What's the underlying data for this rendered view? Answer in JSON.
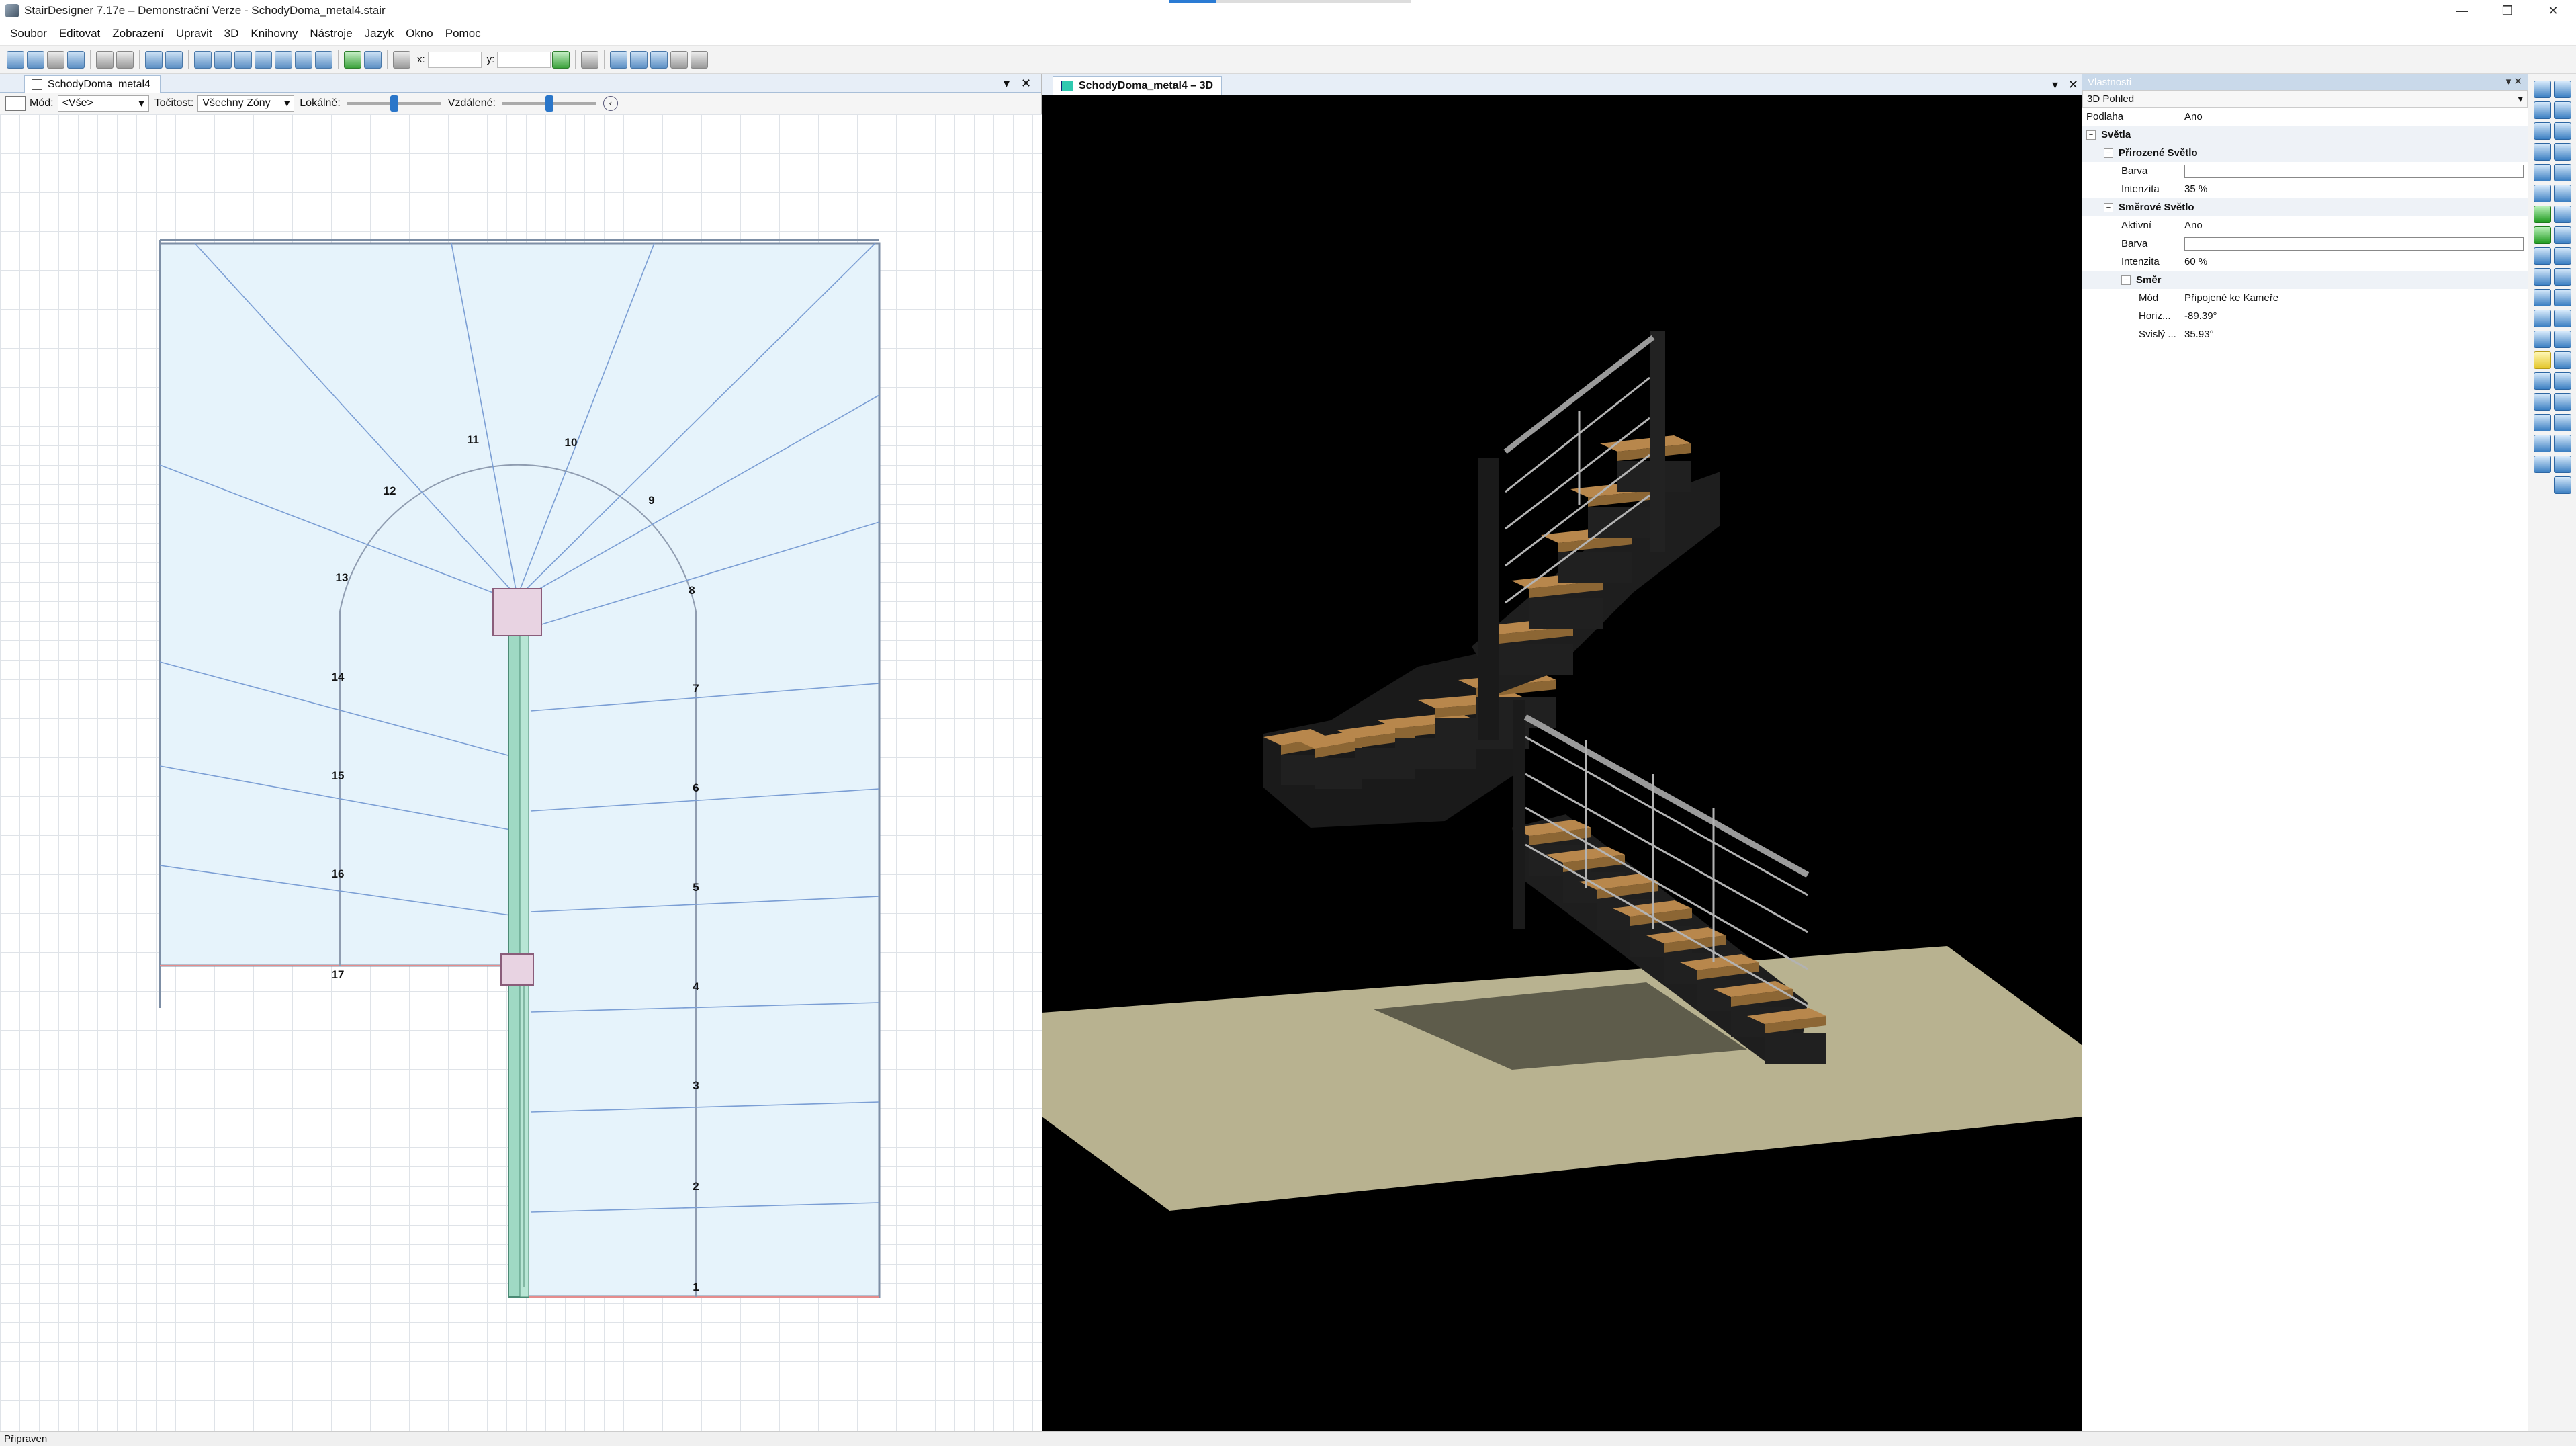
{
  "window": {
    "title": "StairDesigner 7.17e – Demonstrační Verze - SchodyDoma_metal4.stair"
  },
  "menu": [
    "Soubor",
    "Editovat",
    "Zobrazení",
    "Upravit",
    "3D",
    "Knihovny",
    "Nástroje",
    "Jazyk",
    "Okno",
    "Pomoc"
  ],
  "toolbar": {
    "x_label": "x:",
    "y_label": "y:"
  },
  "plan": {
    "tab": "SchodyDoma_metal4",
    "mode_label": "Mód:",
    "mode_value": "<Vše>",
    "turning_label": "Točitost:",
    "turning_value": "Všechny Zóny",
    "local_label": "Lokálně:",
    "remote_label": "Vzdálené:",
    "local_level": 0.5,
    "remote_level": 0.5,
    "step_numbers": [
      "1",
      "2",
      "3",
      "4",
      "5",
      "6",
      "7",
      "8",
      "9",
      "10",
      "11",
      "12",
      "13",
      "14",
      "15",
      "16",
      "17"
    ]
  },
  "view3d": {
    "tab": "SchodyDoma_metal4 – 3D"
  },
  "properties": {
    "header": "Vlastnosti",
    "header_controls": "▾ ✕",
    "object": "3D Pohled",
    "rows": [
      {
        "type": "row",
        "key": "Podlaha",
        "value": "Ano",
        "indent": 0
      },
      {
        "type": "cat",
        "key": "Světla",
        "indent": 0
      },
      {
        "type": "cat",
        "key": "Přirozené Světlo",
        "indent": 1
      },
      {
        "type": "color",
        "key": "Barva",
        "indent": 2
      },
      {
        "type": "row",
        "key": "Intenzita",
        "value": "35 %",
        "indent": 2
      },
      {
        "type": "cat",
        "key": "Směrové Světlo",
        "indent": 1
      },
      {
        "type": "row",
        "key": "Aktivní",
        "value": "Ano",
        "indent": 2
      },
      {
        "type": "color",
        "key": "Barva",
        "indent": 2
      },
      {
        "type": "row",
        "key": "Intenzita",
        "value": "60 %",
        "indent": 2
      },
      {
        "type": "cat",
        "key": "Směr",
        "indent": 2
      },
      {
        "type": "row",
        "key": "Mód",
        "value": "Připojené ke Kameře",
        "indent": 3
      },
      {
        "type": "row",
        "key": "Horiz...",
        "value": "-89.39°",
        "indent": 3
      },
      {
        "type": "row",
        "key": "Svislý ...",
        "value": "35.93°",
        "indent": 3
      }
    ]
  },
  "status": {
    "text": "Připraven"
  },
  "colors": {
    "floor": "#b8b290",
    "stringer": "#222222",
    "tread": "#9c7440",
    "plan_fill": "#e6f3fb",
    "post": "#9fd9c4",
    "newel": "#e8d3e2"
  }
}
